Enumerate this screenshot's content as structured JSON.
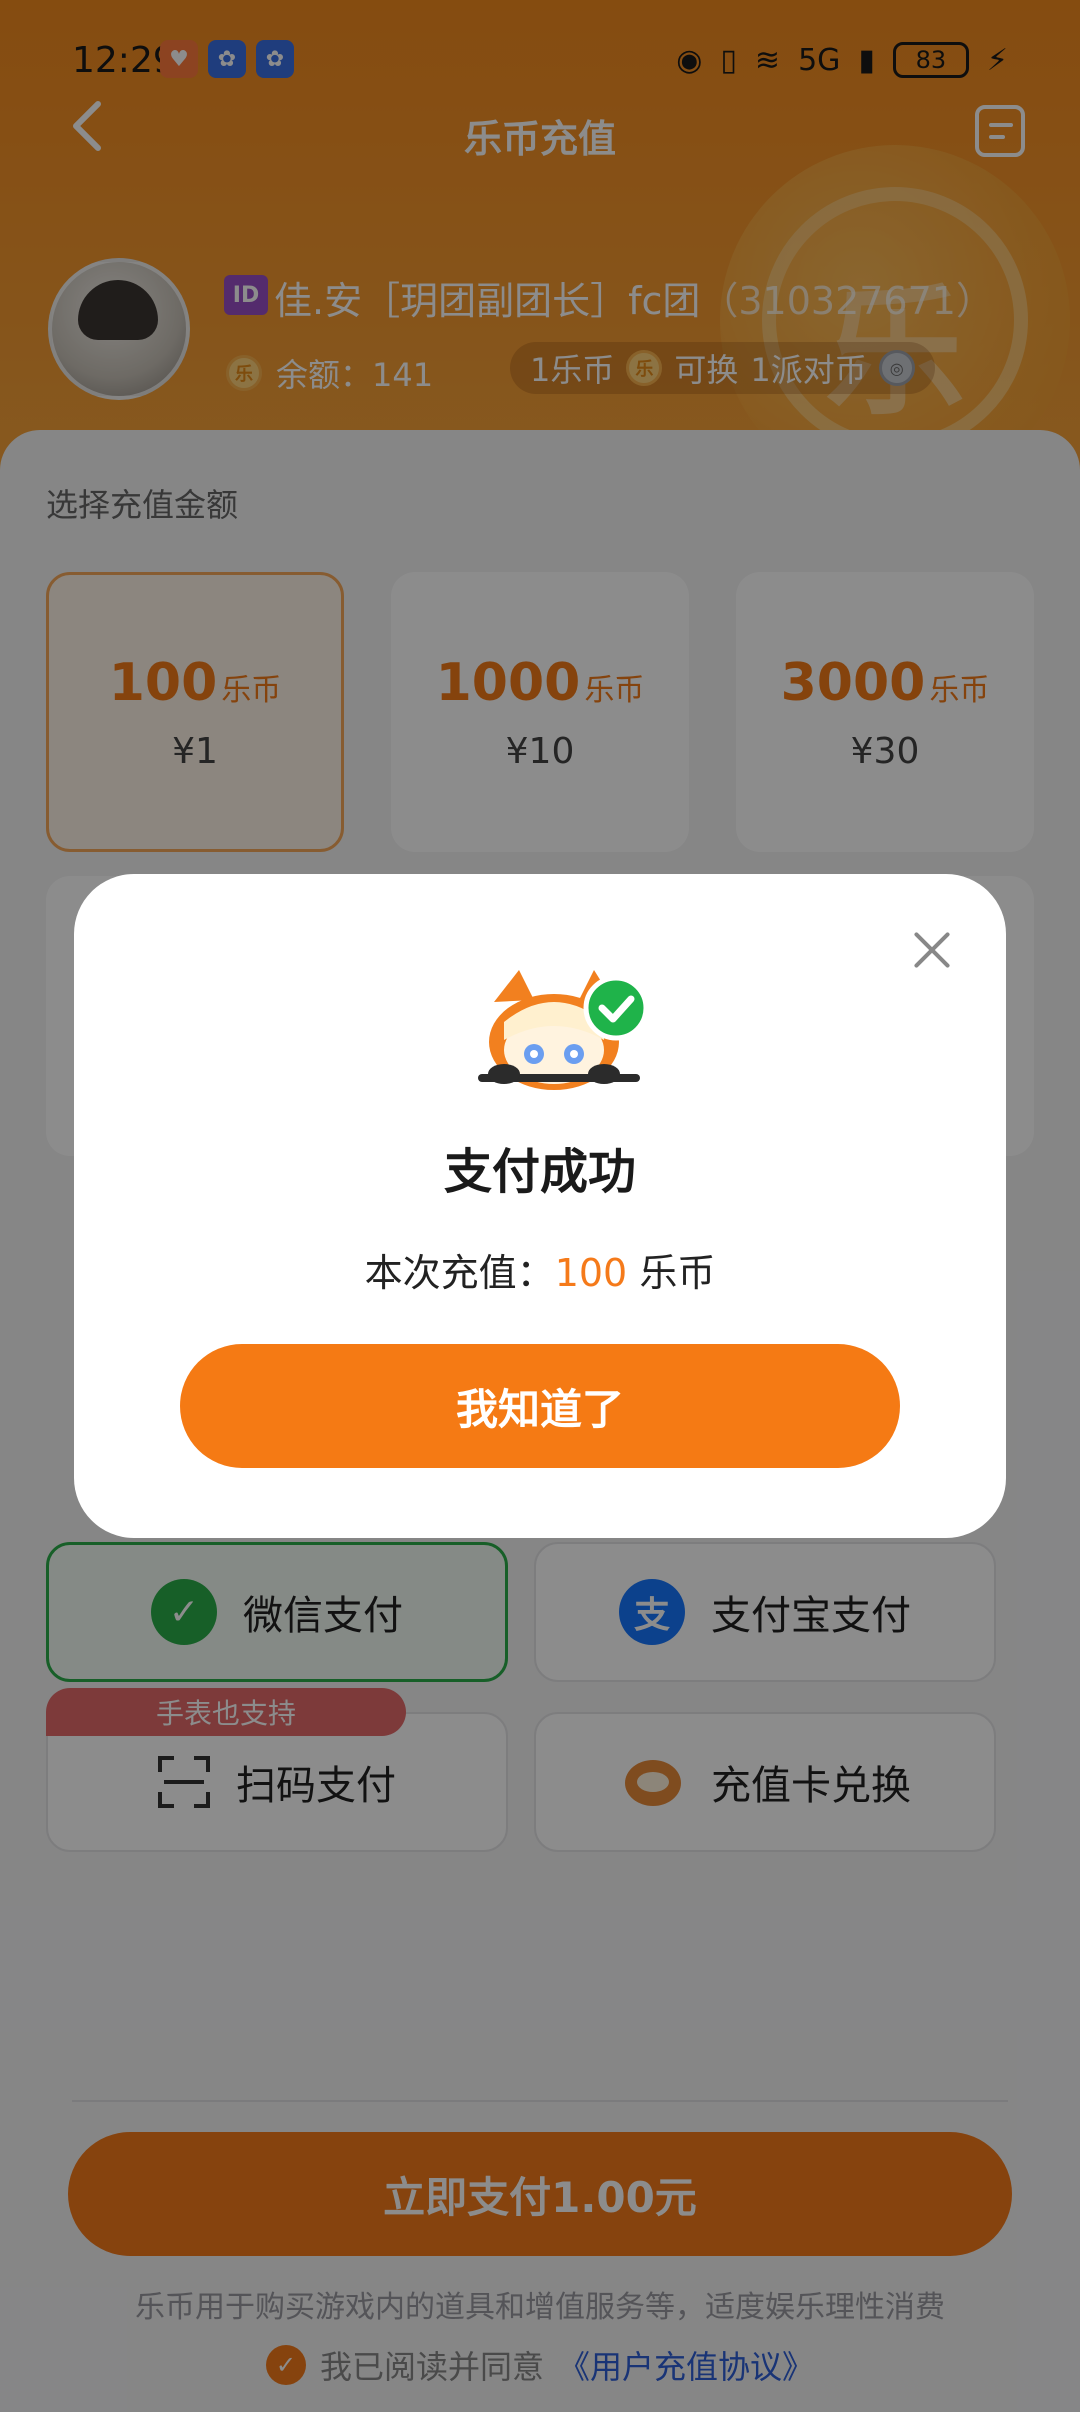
{
  "status_bar": {
    "time": "12:29",
    "network": "5G",
    "battery": "83"
  },
  "header": {
    "title": "乐币充值",
    "coin_glyph": "乐",
    "id_badge": "ID",
    "username": "佳.安［玥团副团长］fc团",
    "user_id": "（310327671）",
    "coin_icon_glyph": "乐",
    "balance_label": "余额：",
    "balance_value": "141",
    "rate_left": "1乐币",
    "rate_mid": "可换",
    "rate_right": "1派对币"
  },
  "section_title": "选择充值金额",
  "amounts": [
    {
      "coins": "100",
      "unit": "乐币",
      "price": "¥1"
    },
    {
      "coins": "1000",
      "unit": "乐币",
      "price": "¥10"
    },
    {
      "coins": "3000",
      "unit": "乐币",
      "price": "¥30"
    }
  ],
  "payment_methods": {
    "wechat": "微信支付",
    "alipay": "支付宝支付",
    "alipay_glyph": "支",
    "scan": "扫码支付",
    "card": "充值卡兑换",
    "watch_tag": "手表也支持"
  },
  "footer": {
    "submit": "立即支付1.00元",
    "disclaimer": "乐币用于购买游戏内的道具和增值服务等，适度娱乐理性消费",
    "agree_prefix": "我已阅读并同意",
    "agreement_link": "《用户充值协议》"
  },
  "modal": {
    "title": "支付成功",
    "desc_prefix": "本次充值：",
    "amount": "100",
    "unit": "乐币",
    "ok_button": "我知道了"
  }
}
